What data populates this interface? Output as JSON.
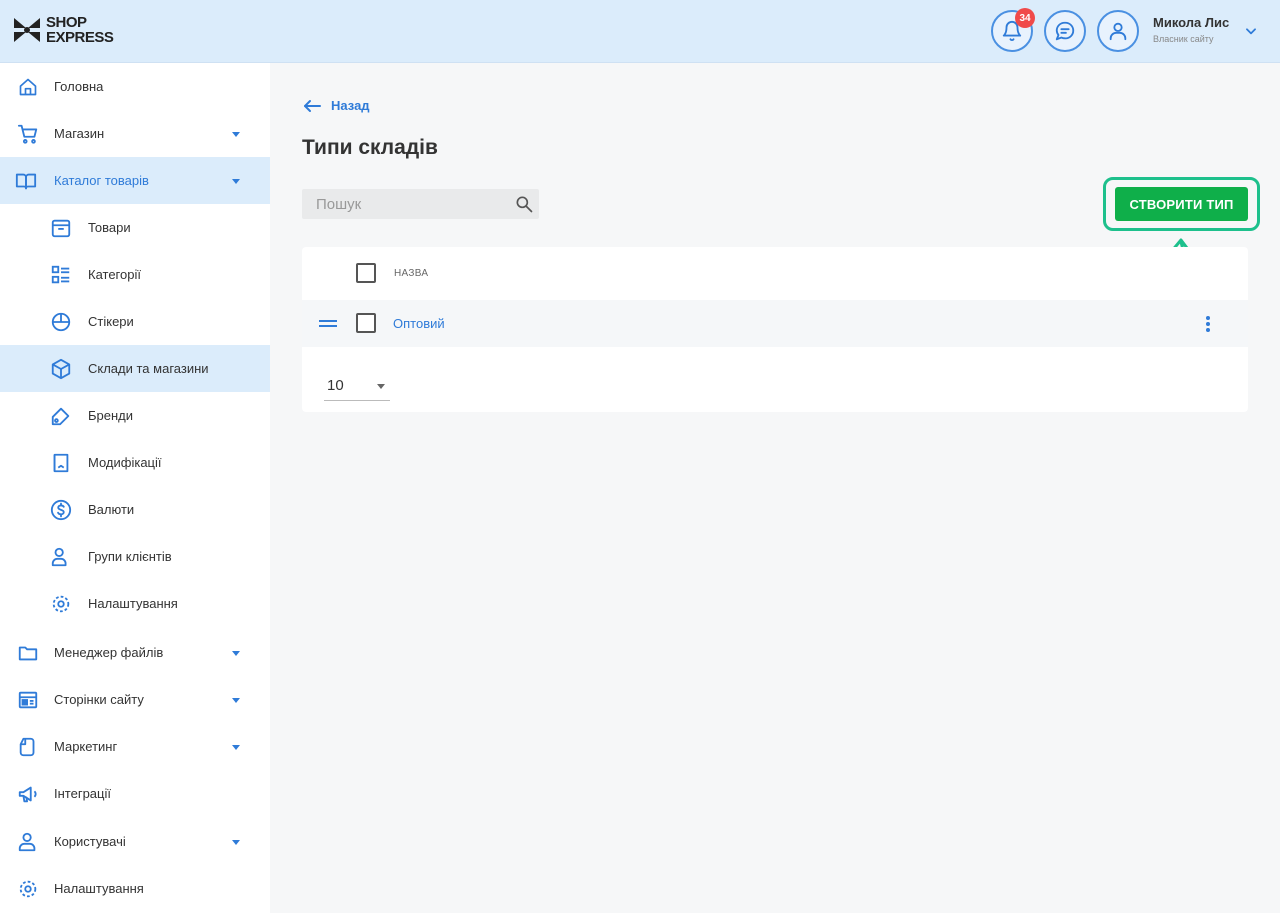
{
  "header": {
    "logo_line1": "SHOP",
    "logo_line2": "EXPRESS",
    "notifications_count": "34",
    "user_name": "Микола Лис",
    "user_role": "Власник сайту"
  },
  "sidebar": {
    "items": [
      {
        "label": "Головна",
        "icon": "home-icon"
      },
      {
        "label": "Магазин",
        "icon": "cart-icon",
        "expandable": true
      },
      {
        "label": "Каталог товарів",
        "icon": "catalog-book-icon",
        "expandable": true,
        "active": true
      },
      {
        "label": "Товари",
        "icon": "product-box-icon"
      },
      {
        "label": "Категорії",
        "icon": "categories-list-icon"
      },
      {
        "label": "Стікери",
        "icon": "sticker-icon"
      },
      {
        "label": "Склади та магазини",
        "icon": "warehouse-cube-icon",
        "active": true
      },
      {
        "label": "Бренди",
        "icon": "tag-icon"
      },
      {
        "label": "Модифікації",
        "icon": "bookmark-icon"
      },
      {
        "label": "Валюти",
        "icon": "dollar-icon"
      },
      {
        "label": "Групи клієнтів",
        "icon": "users-icon"
      },
      {
        "label": "Налаштування",
        "icon": "gear-icon"
      },
      {
        "label": "Менеджер файлів",
        "icon": "folder-icon",
        "expandable": true
      },
      {
        "label": "Сторінки сайту",
        "icon": "pages-icon",
        "expandable": true
      },
      {
        "label": "Маркетинг",
        "icon": "marketing-icon",
        "expandable": true
      },
      {
        "label": "Інтеграції",
        "icon": "megaphone-icon"
      },
      {
        "label": "Користувачі",
        "icon": "user-icon",
        "expandable": true
      },
      {
        "label": "Налаштування",
        "icon": "gear-icon"
      }
    ]
  },
  "main": {
    "back_label": "Назад",
    "title": "Типи складів",
    "search_placeholder": "Пошук",
    "create_button": "СТВОРИТИ ТИП",
    "table": {
      "column_name": "НАЗВА",
      "rows": [
        {
          "name": "Оптовий"
        }
      ]
    },
    "page_size": "10"
  },
  "colors": {
    "accent": "#2f7bd8",
    "header_bg": "#dbecfb",
    "create_green": "#0faf4a",
    "highlight_teal": "#1dc08c",
    "badge_red": "#f04a4a"
  }
}
